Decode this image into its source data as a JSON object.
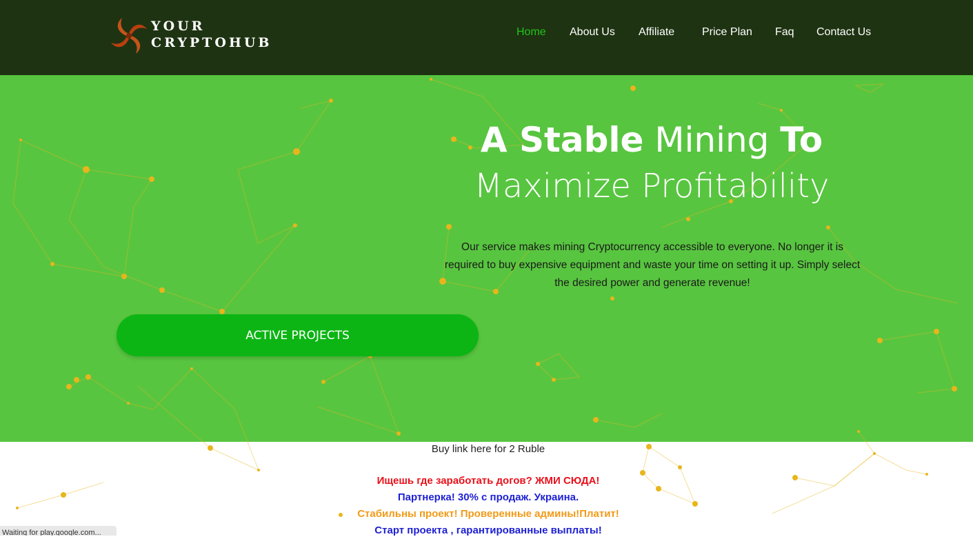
{
  "header": {
    "logo": {
      "line1": "YOUR",
      "line2": "CRYPTOHUB",
      "icon": "swirl-logo-icon"
    },
    "nav": [
      {
        "label": "Home",
        "active": true
      },
      {
        "label": "About Us",
        "active": false
      },
      {
        "label": "Affiliate",
        "active": false
      },
      {
        "label": "Price Plan",
        "active": false
      },
      {
        "label": "Faq",
        "active": false
      },
      {
        "label": "Contact Us",
        "active": false
      }
    ]
  },
  "hero": {
    "headline": {
      "w1": "A Stable",
      "w2": " Mining ",
      "w3": "To",
      "line2": "Maximize Profitability"
    },
    "description": "Our service makes mining Cryptocurrency accessible to everyone. No longer it is required to buy expensive equipment and waste your time on setting it up. Simply select the desired power and generate revenue!",
    "cta_label": "ACTIVE PROJECTS"
  },
  "promo": {
    "buy_link": "Buy link here for 2 Ruble",
    "lines": [
      {
        "text": "Ищешь где заработать догов? ЖМИ СЮДА!",
        "color": "#e8101a"
      },
      {
        "text": "Партнерка! 30% с продаж. Украина.",
        "color": "#1d1fd2"
      },
      {
        "text": "Стабильны проект! Проверенные админы!Платит!",
        "color": "#f29a18"
      },
      {
        "text": "Старт проекта , гарантированные выплаты!",
        "color": "#1d1fd2"
      }
    ]
  },
  "status_bar": {
    "text": "Waiting for play.google.com..."
  },
  "colors": {
    "header_bg": "#1e3312",
    "hero_bg": "#58c540",
    "nav_active": "#22c51a",
    "cta_bg": "#0cb514",
    "network_dots": "#e8b51c"
  }
}
